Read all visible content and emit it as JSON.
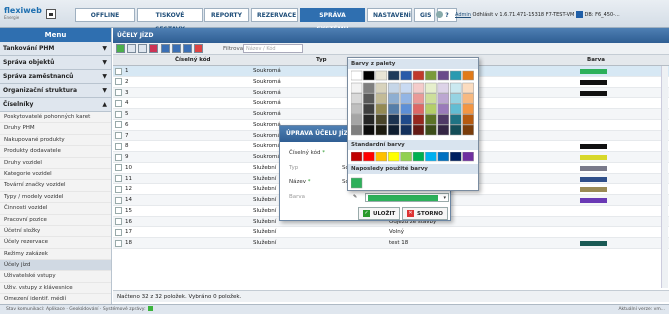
{
  "app": {
    "logo": "flexiweb",
    "logo_sub": "Energie"
  },
  "top_tabs": [
    {
      "label": "OFFLINE",
      "active": false
    },
    {
      "label": "TISKOVÉ SESTAVY",
      "active": false
    },
    {
      "label": "REPORTY",
      "active": false
    },
    {
      "label": "REZERVACE",
      "active": false
    },
    {
      "label": "SPRÁVA SYSTÉMU",
      "active": true
    },
    {
      "label": "NASTAVENÍ",
      "active": false
    },
    {
      "label": "GIS",
      "active": false
    },
    {
      "label": "?",
      "active": false
    }
  ],
  "user": {
    "name": "Admin",
    "logout": "Odhlásit",
    "version": "v 1.6.71.471-15318 F7-TEST-VM",
    "db": "DB: F6_450-..."
  },
  "sidebar": {
    "title": "Menu",
    "sections": [
      {
        "label": "Tankování PHM",
        "open": false
      },
      {
        "label": "Správa objektů",
        "open": false
      },
      {
        "label": "Správa zaměstnanců",
        "open": false
      },
      {
        "label": "Organizační struktura",
        "open": false
      },
      {
        "label": "Číselníky",
        "open": true
      }
    ],
    "items": [
      "Poskytovatelé pohonných karet",
      "Druhy PHM",
      "Nakupované produkty",
      "Produkty dodavatele",
      "Druhy vozidel",
      "Kategorie vozidel",
      "Tovární značky vozidel",
      "Typy / modely vozidel",
      "Činnosti vozidel",
      "Pracovní pozice",
      "Účetní složky",
      "Účely rezervace",
      "Režimy zakázek",
      "Účely jízd",
      "Uživatelské vstupy",
      "Uživ. vstupy z klávesnice",
      "Omezení identif. médií"
    ],
    "active_item": "Účely jízd"
  },
  "panel": {
    "title": "ÚČELY JÍZD",
    "filter_label": "Filtrovat",
    "filter_placeholder": "Název / Kód",
    "columns": {
      "code": "Číselný kód",
      "type": "Typ",
      "color": "Barva"
    },
    "footer": "Načteno 32 z 32 položek. Vybráno 0 položek."
  },
  "rows": [
    {
      "code": "1",
      "type": "Soukromá",
      "desc": "",
      "color": "#2db05a",
      "selected": true
    },
    {
      "code": "2",
      "type": "Soukromá",
      "desc": "",
      "color": "#111111",
      "selected": false
    },
    {
      "code": "3",
      "type": "Soukromá",
      "desc": "",
      "color": "#111111",
      "selected": false
    },
    {
      "code": "4",
      "type": "Soukromá",
      "desc": "",
      "color": "",
      "selected": false
    },
    {
      "code": "5",
      "type": "Soukromá",
      "desc": "",
      "color": "",
      "selected": false
    },
    {
      "code": "6",
      "type": "Soukromá",
      "desc": "",
      "color": "",
      "selected": false
    },
    {
      "code": "7",
      "type": "Soukromá",
      "desc": "",
      "color": "",
      "selected": false
    },
    {
      "code": "8",
      "type": "Soukromá",
      "desc": "",
      "color": "#111111",
      "selected": false
    },
    {
      "code": "9",
      "type": "Soukromá",
      "desc": "",
      "color": "#d8d82a",
      "selected": false
    },
    {
      "code": "10",
      "type": "Služební",
      "desc": "",
      "color": "#7a7a8a",
      "selected": false
    },
    {
      "code": "11",
      "type": "Služební",
      "desc": "",
      "color": "#2f4f8a",
      "selected": false
    },
    {
      "code": "12",
      "type": "Služební",
      "desc": "",
      "color": "#9a8a55",
      "selected": false
    },
    {
      "code": "14",
      "type": "Služební",
      "desc": "",
      "color": "#6a3ab5",
      "selected": false
    },
    {
      "code": "15",
      "type": "Služební",
      "desc": "Vykládka HR",
      "color": "",
      "selected": false
    },
    {
      "code": "16",
      "type": "Služební",
      "desc": "Odjezd ze stavby",
      "color": "",
      "selected": false
    },
    {
      "code": "17",
      "type": "Služební",
      "desc": "Volný",
      "color": "",
      "selected": false
    },
    {
      "code": "18",
      "type": "Služební",
      "desc": "test 18",
      "color": "#1a5a55",
      "selected": false
    }
  ],
  "dialog": {
    "title": "ÚPRAVA ÚČELU JÍZDY",
    "code_label": "Číselný kód",
    "type_label": "Typ",
    "type_value": "So",
    "name_label": "Název",
    "name_value": "So",
    "color_label": "Barva",
    "color_value": "#2db05a",
    "save_label": "ULOŽIT",
    "cancel_label": "STORNO",
    "required_mark": "*"
  },
  "color_picker": {
    "palette_title": "Barvy z palety",
    "standard_title": "Standardní barvy",
    "recent_title": "Naposledy použité barvy",
    "top_row": [
      "#ffffff",
      "#000000",
      "#e8e4d6",
      "#1f3a5a",
      "#2a5aa8",
      "#c0392b",
      "#7a9a3a",
      "#6a4a8a",
      "#2a9ab0",
      "#e07a1a"
    ],
    "tints": [
      [
        "#f2f2f2",
        "#7f7f7f",
        "#d8d3bd",
        "#c6d6e8",
        "#c9daf2",
        "#f4cccb",
        "#e6efcd",
        "#ddd3e8",
        "#cbe9f0",
        "#fbdcc0"
      ],
      [
        "#d9d9d9",
        "#595959",
        "#c3bb97",
        "#8eaed1",
        "#93b5e4",
        "#e99a98",
        "#cddf9b",
        "#bca7d1",
        "#96d3e2",
        "#f7b981"
      ],
      [
        "#bfbfbf",
        "#3f3f3f",
        "#948a54",
        "#567ea9",
        "#5d8fd6",
        "#dd6866",
        "#b4cf69",
        "#9a7bba",
        "#62bdd3",
        "#f39643"
      ],
      [
        "#a5a5a5",
        "#262626",
        "#4a452a",
        "#1c3350",
        "#1f4a8a",
        "#96281f",
        "#5b7326",
        "#4f3a66",
        "#1f7384",
        "#b55a10"
      ],
      [
        "#7f7f7f",
        "#0c0c0c",
        "#1d1b10",
        "#0f1e30",
        "#13305c",
        "#641a15",
        "#3c4d19",
        "#342644",
        "#144d58",
        "#793c0b"
      ]
    ],
    "standard": [
      "#c00000",
      "#ff0000",
      "#ffc000",
      "#ffff00",
      "#92d050",
      "#00b050",
      "#00b0f0",
      "#0070c0",
      "#002060",
      "#7030a0"
    ],
    "recent": [
      "#2db05a"
    ]
  },
  "status": {
    "text": "Stav komunikací: Aplikace  ·  Geokódování  ·  Systémové zprávy:",
    "right": "Aktuální verze: vm..."
  }
}
